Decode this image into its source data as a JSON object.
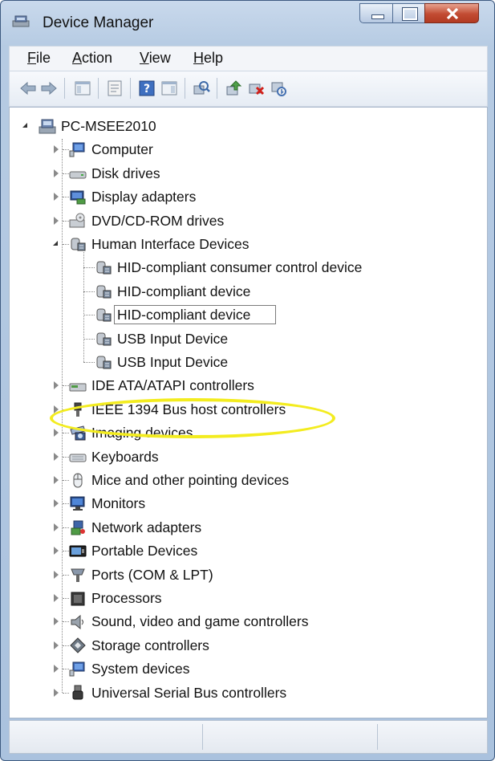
{
  "window": {
    "title": "Device Manager"
  },
  "menu": [
    {
      "label": "File",
      "key": "F",
      "rest": "ile"
    },
    {
      "label": "Action",
      "key": "A",
      "rest": "ction"
    },
    {
      "label": "View",
      "key": "V",
      "rest": "iew"
    },
    {
      "label": "Help",
      "key": "H",
      "rest": "elp"
    }
  ],
  "toolbar": {
    "buttons": [
      "back-icon",
      "forward-icon",
      "console-tree-icon",
      "properties-icon",
      "help-icon",
      "action-pane-icon",
      "scan-hardware-icon",
      "update-driver-icon",
      "uninstall-icon",
      "disable-icon"
    ]
  },
  "tree": {
    "root": "PC-MSEE2010",
    "categories": [
      "Computer",
      "Disk drives",
      "Display adapters",
      "DVD/CD-ROM drives",
      "Human Interface Devices",
      "IDE ATA/ATAPI controllers",
      "IEEE 1394 Bus host controllers",
      "Imaging devices",
      "Keyboards",
      "Mice and other pointing devices",
      "Monitors",
      "Network adapters",
      "Portable Devices",
      "Ports (COM & LPT)",
      "Processors",
      "Sound, video and game controllers",
      "Storage controllers",
      "System devices",
      "Universal Serial Bus controllers"
    ],
    "hid_children": [
      "HID-compliant consumer control device",
      "HID-compliant device",
      "HID-compliant device",
      "USB Input Device",
      "USB Input Device"
    ],
    "selected_child_index": 2
  },
  "colors": {
    "highlight_ellipse": "#f3ec1f",
    "frame": "#b6cbe3"
  }
}
